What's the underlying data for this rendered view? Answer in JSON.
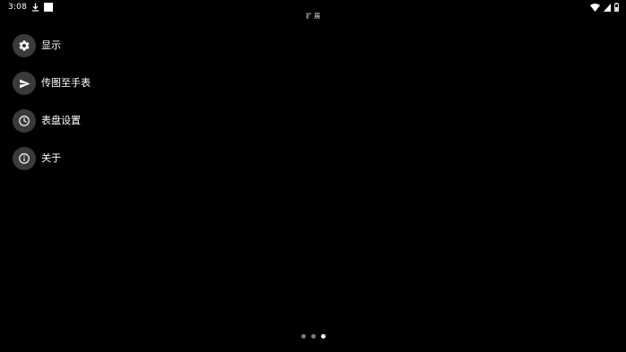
{
  "status_bar": {
    "time": "3:08",
    "icons": [
      "download-icon",
      "notification-square-icon",
      "wifi-icon",
      "cellular-signal-icon",
      "battery-icon"
    ]
  },
  "center_label": "扩 展",
  "menu": {
    "items": [
      {
        "icon": "gear-icon",
        "label": "显示"
      },
      {
        "icon": "send-icon",
        "label": "传图至手表"
      },
      {
        "icon": "clock-icon",
        "label": "表盘设置"
      },
      {
        "icon": "info-icon",
        "label": "关于"
      }
    ]
  },
  "pager": {
    "count": 3,
    "active_index": 2
  },
  "colors": {
    "background": "#000000",
    "icon_circle": "#3a3a3a",
    "text": "#ffffff",
    "dot_inactive": "#7a7a7a",
    "dot_active": "#ffffff"
  }
}
